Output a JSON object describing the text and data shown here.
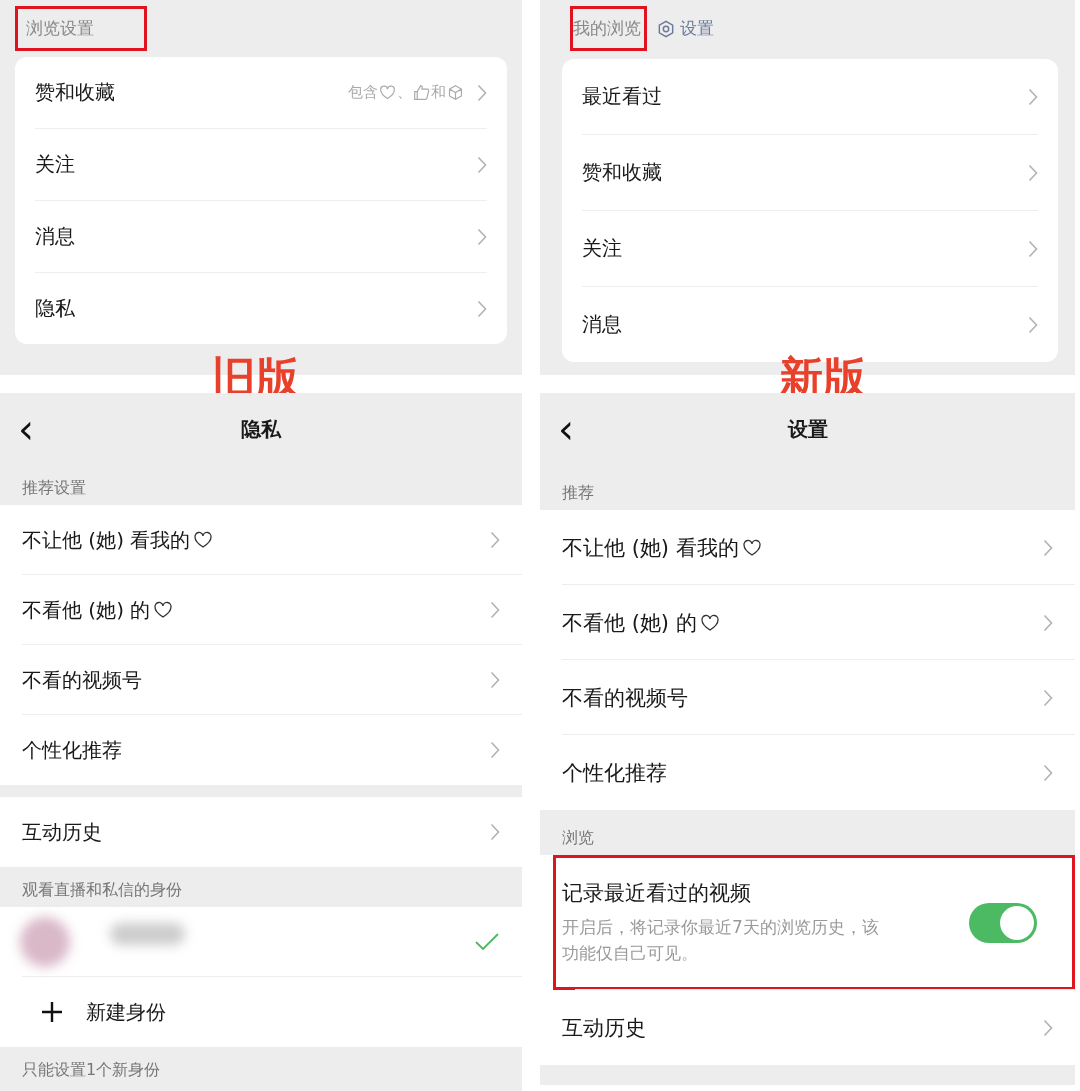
{
  "screens": [
    {
      "version_label": "旧版",
      "browse_panel": {
        "header": {
          "title": "浏览设置",
          "highlighted": true
        },
        "items": [
          {
            "label": "赞和收藏",
            "detail": [
              {
                "kind": "text",
                "text": "包含"
              },
              {
                "kind": "heart"
              },
              {
                "kind": "text",
                "text": "、"
              },
              {
                "kind": "thumb"
              },
              {
                "kind": "text",
                "text": "和"
              },
              {
                "kind": "cube"
              }
            ]
          },
          {
            "label": "关注"
          },
          {
            "label": "消息"
          },
          {
            "label": "隐私"
          }
        ]
      },
      "page": {
        "title": "隐私",
        "back": "‹",
        "sections": [
          {
            "header": "推荐设置",
            "rows": [
              {
                "kind": "link",
                "label": "不让他 (她) 看我的",
                "trailing_icon": true
              },
              {
                "kind": "link",
                "label": "不看他 (她) 的",
                "trailing_icon": true
              },
              {
                "kind": "link",
                "label": "不看的视频号"
              },
              {
                "kind": "link",
                "label": "个性化推荐"
              }
            ]
          },
          {
            "rows": [
              {
                "kind": "link",
                "label": "互动历史"
              }
            ]
          },
          {
            "header": "观看直播和私信的身份",
            "rows": [
              {
                "kind": "identity",
                "selected": true
              },
              {
                "kind": "add",
                "label": "新建身份"
              }
            ]
          },
          {
            "header": "只能设置1个新身份"
          }
        ]
      }
    },
    {
      "version_label": "新版",
      "browse_panel": {
        "header": {
          "title": "我的浏览",
          "highlighted": true,
          "link": "设置"
        },
        "items": [
          {
            "label": "最近看过"
          },
          {
            "label": "赞和收藏"
          },
          {
            "label": "关注"
          },
          {
            "label": "消息"
          }
        ]
      },
      "page": {
        "title": "设置",
        "back": "‹",
        "sections": [
          {
            "header": "推荐",
            "rows": [
              {
                "kind": "link",
                "label": "不让他 (她) 看我的",
                "trailing_icon": true
              },
              {
                "kind": "link",
                "label": "不看他 (她) 的",
                "trailing_icon": true
              },
              {
                "kind": "link",
                "label": "不看的视频号"
              },
              {
                "kind": "link",
                "label": "个性化推荐"
              }
            ]
          },
          {
            "header": "浏览",
            "rows": [
              {
                "kind": "toggle",
                "label": "记录最近看过的视频",
                "description": "开启后，将记录你最近7天的浏览历史，该功能仅自己可见。",
                "on": true,
                "highlighted": true
              },
              {
                "kind": "link",
                "label": "互动历史"
              }
            ]
          }
        ]
      }
    }
  ]
}
